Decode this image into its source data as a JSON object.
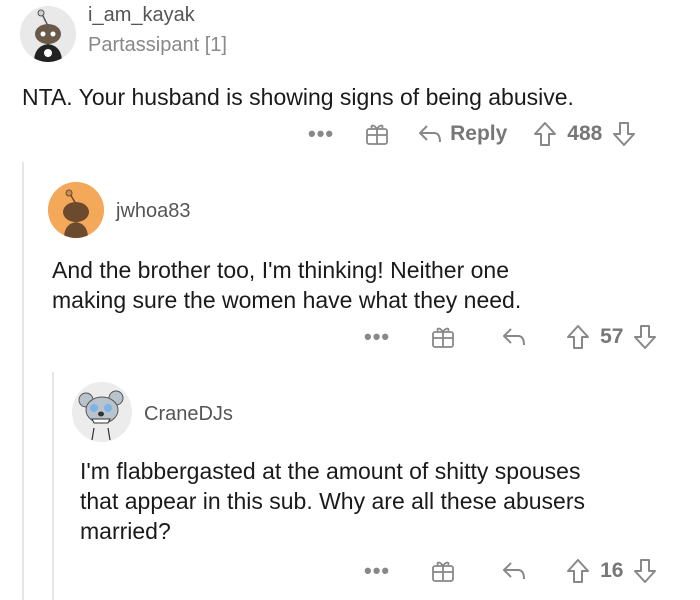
{
  "comments": [
    {
      "username": "i_am_kayak",
      "flair": "Partassipant [1]",
      "body": "NTA. Your husband is showing signs of being abusive.",
      "more_label": "•••",
      "reply_label": "Reply",
      "score": "488",
      "avatar_icon": "snoo-avatar-icon"
    },
    {
      "username": "jwhoa83",
      "body": "And the brother too, I'm thinking!  Neither one\nmaking sure the women have what they need.",
      "more_label": "•••",
      "score": "57",
      "avatar_icon": "snoo-avatar-icon"
    },
    {
      "username": "CraneDJs",
      "body": "I'm flabbergasted at the amount of shitty spouses\nthat appear in this sub. Why are all these abusers\nmarried?",
      "more_label": "•••",
      "score": "16",
      "avatar_icon": "koala-avatar-icon"
    }
  ],
  "colors": {
    "text": "#1a1a1b",
    "muted": "#888888",
    "thread_line": "#e6e6e6",
    "avatar_orange": "#f4a85a",
    "avatar_gray": "#e8e8e8"
  }
}
